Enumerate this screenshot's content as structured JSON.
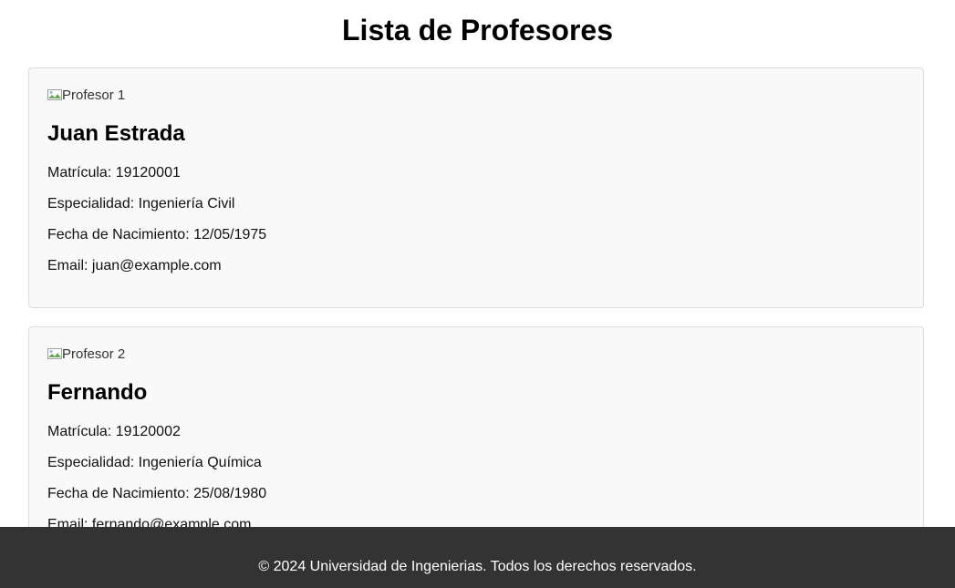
{
  "page": {
    "title": "Lista de Profesores"
  },
  "teachers": [
    {
      "photo_alt": "Profesor 1",
      "name": "Juan Estrada",
      "matricula": "Matrícula: 19120001",
      "especialidad": "Especialidad: Ingeniería Civil",
      "fecha_nacimiento": "Fecha de Nacimiento: 12/05/1975",
      "email": "Email: juan@example.com"
    },
    {
      "photo_alt": "Profesor 2",
      "name": "Fernando",
      "matricula": "Matrícula: 19120002",
      "especialidad": "Especialidad: Ingeniería Química",
      "fecha_nacimiento": "Fecha de Nacimiento: 25/08/1980",
      "email": "Email: fernando@example.com"
    }
  ],
  "footer": {
    "text": "© 2024 Universidad de Ingenierias. Todos los derechos reservados."
  },
  "icons": {
    "photo": "broken-image-icon"
  },
  "colors": {
    "footer_bg": "#333333",
    "card_border": "#dcdcdc",
    "card_bg": "#f9f9f9"
  }
}
